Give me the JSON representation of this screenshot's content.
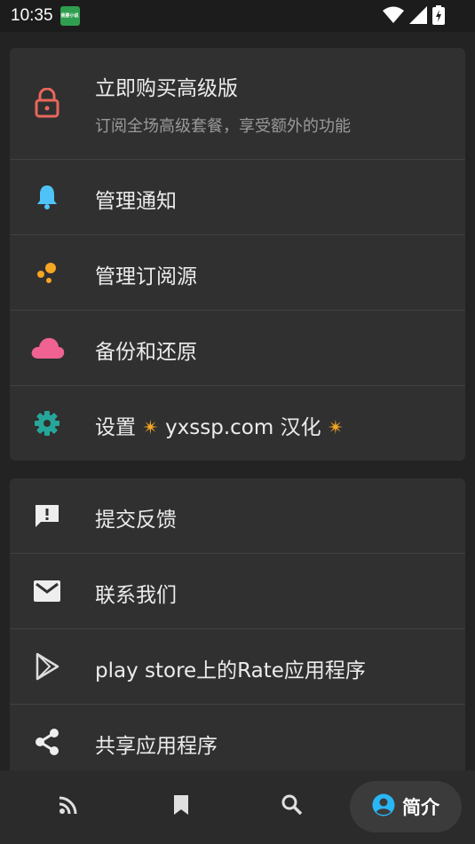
{
  "status_bar": {
    "time": "10:35",
    "app_icon_text": "我要小说"
  },
  "menu_primary": {
    "premium": {
      "title": "立即购买高级版",
      "subtitle": "订阅全场高级套餐，享受额外的功能",
      "icon": "lock-icon",
      "icon_color": "#e8675c"
    },
    "items": [
      {
        "label": "管理通知",
        "icon": "bell-icon",
        "icon_color": "#4fc3f7"
      },
      {
        "label": "管理订阅源",
        "icon": "dots-icon",
        "icon_color": "#f5a623"
      },
      {
        "label": "备份和还原",
        "icon": "cloud-icon",
        "icon_color": "#f06292"
      },
      {
        "label_prefix": "设置",
        "label_text": "yxssp.com 汉化",
        "icon": "gear-icon",
        "icon_color": "#26a69a"
      }
    ]
  },
  "menu_secondary": {
    "items": [
      {
        "label": "提交反馈",
        "icon": "feedback-icon"
      },
      {
        "label": "联系我们",
        "icon": "mail-icon"
      },
      {
        "label": "play store上的Rate应用程序",
        "icon": "play-store-icon"
      },
      {
        "label": "共享应用程序",
        "icon": "share-icon"
      }
    ]
  },
  "bottom_nav": {
    "items": [
      {
        "icon": "rss-icon"
      },
      {
        "icon": "bookmark-icon"
      },
      {
        "icon": "search-icon"
      }
    ],
    "active": {
      "label": "简介",
      "icon": "profile-icon",
      "icon_color": "#29b6f6"
    }
  }
}
